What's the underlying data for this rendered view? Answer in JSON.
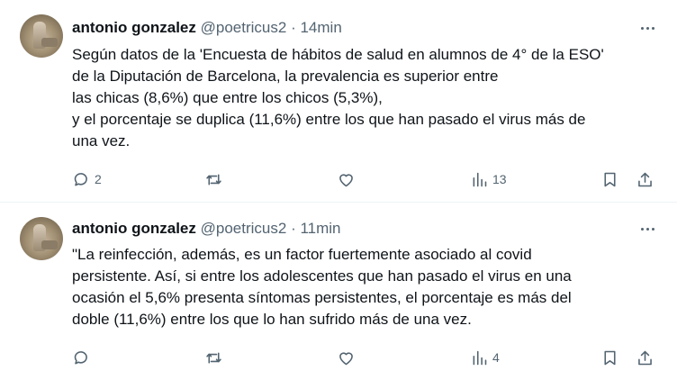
{
  "colors": {
    "text": "#0f1419",
    "muted": "#536471",
    "divider": "#eff3f4"
  },
  "tweets": [
    {
      "author_name": "antonio gonzalez",
      "handle": "@poetricus2",
      "separator": "·",
      "time": "14min",
      "lines": [
        "Según datos de la 'Encuesta de hábitos de salud en alumnos de 4° de la ESO'",
        "de la Diputación de Barcelona, la prevalencia es superior entre",
        "las chicas (8,6%) que entre los chicos (5,3%),",
        "y el porcentaje se duplica (11,6%) entre los que han pasado el virus más de",
        "una vez."
      ],
      "reply_count": "2",
      "retweet_count": "",
      "like_count": "",
      "view_count": "13"
    },
    {
      "author_name": "antonio gonzalez",
      "handle": "@poetricus2",
      "separator": "·",
      "time": "11min",
      "lines": [
        "\"La reinfección, además, es un factor fuertemente asociado al covid",
        "persistente. Así, si entre los adolescentes que han pasado el virus en una",
        "ocasión el 5,6% presenta síntomas persistentes, el porcentaje es más del",
        "doble (11,6%) entre los que lo han sufrido más de una vez."
      ],
      "reply_count": "",
      "retweet_count": "",
      "like_count": "",
      "view_count": "4"
    }
  ],
  "icons": [
    "reply-icon",
    "retweet-icon",
    "like-icon",
    "views-icon",
    "bookmark-icon",
    "share-icon",
    "more-icon"
  ]
}
